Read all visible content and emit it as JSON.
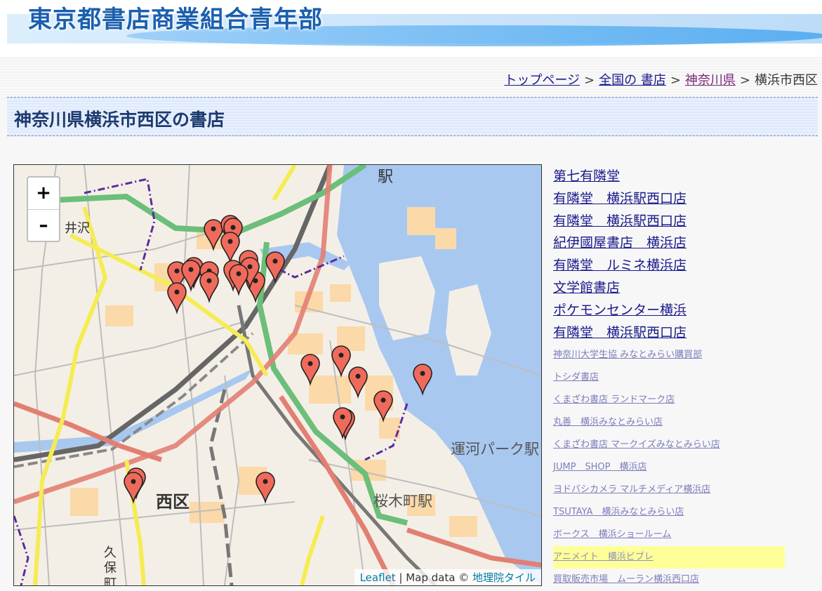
{
  "site": {
    "title": "東京都書店商業組合青年部"
  },
  "breadcrumb": {
    "items": [
      "トップページ",
      "全国の 書店",
      "神奈川県"
    ],
    "current": "横浜市西区",
    "separator": ">"
  },
  "page": {
    "heading": "神奈川県横浜市西区の書店"
  },
  "map": {
    "zoom_in": "+",
    "zoom_out": "–",
    "labels": {
      "station_top": "駅",
      "izawa": "井沢",
      "unga_park": "運河パーク駅",
      "sakuragicho": "桜木町駅",
      "nishiku": "西区",
      "kubo_1": "久",
      "kubo_2": "保",
      "kubo_3": "町"
    },
    "attribution": {
      "leaflet": "Leaflet",
      "mapdata": " | Map data © ",
      "tile": "地理院タイル"
    },
    "marker_count": 26
  },
  "stores": {
    "featured": [
      "第七有隣堂",
      "有隣堂　横浜駅西口店",
      "有隣堂　横浜駅西口店",
      "紀伊國屋書店　横浜店",
      "有隣堂　ルミネ横浜店",
      "文学館書店",
      "ポケモンセンター横浜",
      "有隣堂　横浜駅西口店"
    ],
    "others": [
      "神奈川大学生協 みなとみらい購買部",
      "トシダ書店",
      "くまざわ書店 ランドマーク店",
      "丸善　横浜みなとみらい店",
      "くまざわ書店 マークイズみなとみらい店",
      "JUMP　SHOP　横浜店",
      "ヨドバシカメラ マルチメディア横浜店",
      "TSUTAYA　横浜みなとみらい店",
      "ボークス　横浜ショールーム",
      "アニメイト　横浜ビブレ",
      "買取販売市場　ムーラン横浜西口店"
    ]
  },
  "colors": {
    "water": "#a8c8f0",
    "land": "#f4efe6",
    "marker": "#f06a5b",
    "highlight": "#ffff99"
  }
}
